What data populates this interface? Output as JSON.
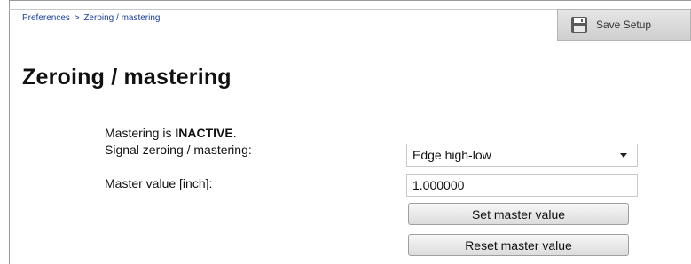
{
  "breadcrumb": {
    "parent": "Preferences",
    "separator": ">",
    "current": "Zeroing / mastering"
  },
  "toolbar": {
    "save_label": "Save Setup"
  },
  "page": {
    "title": "Zeroing / mastering"
  },
  "status": {
    "prefix": "Mastering is ",
    "state": "INACTIVE",
    "suffix": "."
  },
  "form": {
    "signal_label": "Signal zeroing / mastering:",
    "signal_value": "Edge high-low",
    "master_label": "Master value [inch]:",
    "master_value": "1.000000"
  },
  "buttons": {
    "set_master": "Set master value",
    "reset_master": "Reset master value"
  },
  "colors": {
    "breadcrumb_link": "#1a3f9a",
    "save_button_bg": "#d9d9d9"
  }
}
